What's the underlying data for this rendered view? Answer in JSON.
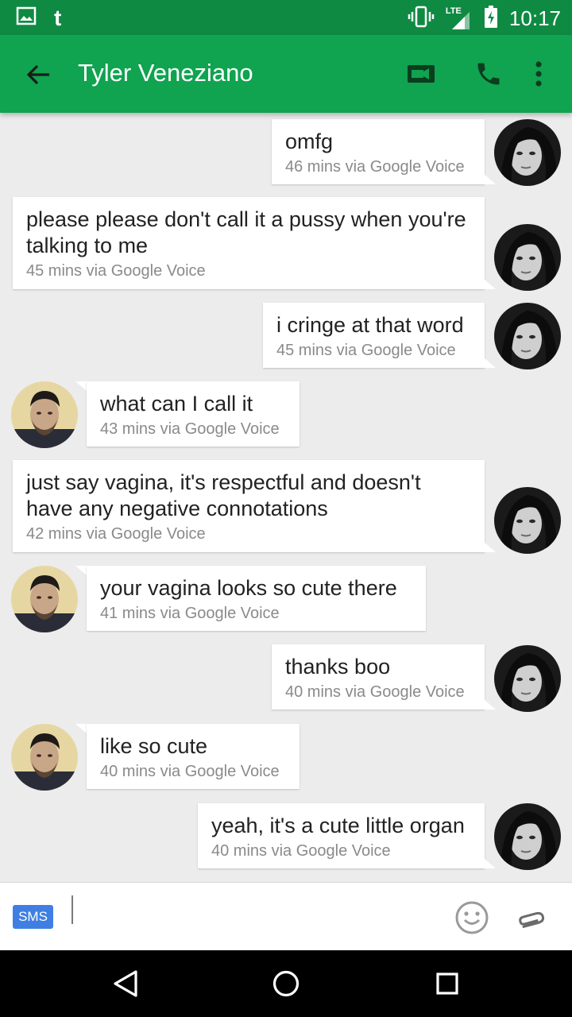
{
  "status_bar": {
    "time": "10:17",
    "network_label": "LTE",
    "icons": [
      "image-icon",
      "tumblr-icon",
      "vibrate-icon",
      "lte-signal-icon",
      "battery-charging-icon"
    ]
  },
  "app_bar": {
    "title": "Tyler Veneziano",
    "icons": [
      "back-arrow-icon",
      "video-call-icon",
      "phone-icon",
      "more-vert-icon"
    ],
    "background": "#10a350",
    "status_background": "#0f8a43"
  },
  "messages": [
    {
      "side": "outgoing",
      "text": "omfg",
      "meta": "46 mins via Google Voice"
    },
    {
      "side": "outgoing",
      "text": "please please don't call it a pussy when you're talking to me",
      "meta": "45 mins via Google Voice"
    },
    {
      "side": "outgoing",
      "text": "i cringe at that word",
      "meta": "45 mins via Google Voice"
    },
    {
      "side": "incoming",
      "text": "what can I call it",
      "meta": "43 mins via Google Voice"
    },
    {
      "side": "outgoing",
      "text": "just say vagina, it's respectful and doesn't have any negative connotations",
      "meta": "42 mins via Google Voice"
    },
    {
      "side": "incoming",
      "text": "your vagina looks so cute there",
      "meta": "41 mins via Google Voice"
    },
    {
      "side": "outgoing",
      "text": "thanks boo",
      "meta": "40 mins via Google Voice"
    },
    {
      "side": "incoming",
      "text": "like so cute",
      "meta": "40 mins via Google Voice"
    },
    {
      "side": "outgoing",
      "text": "yeah, it's a cute little organ",
      "meta": "40 mins via Google Voice"
    }
  ],
  "composer": {
    "sms_label": "SMS",
    "placeholder": "",
    "value": "",
    "icons": [
      "emoji-icon",
      "attachment-icon"
    ],
    "sms_color": "#3f7fe3"
  },
  "nav_bar": {
    "icons": [
      "back-triangle-icon",
      "home-circle-icon",
      "recents-square-icon"
    ]
  }
}
